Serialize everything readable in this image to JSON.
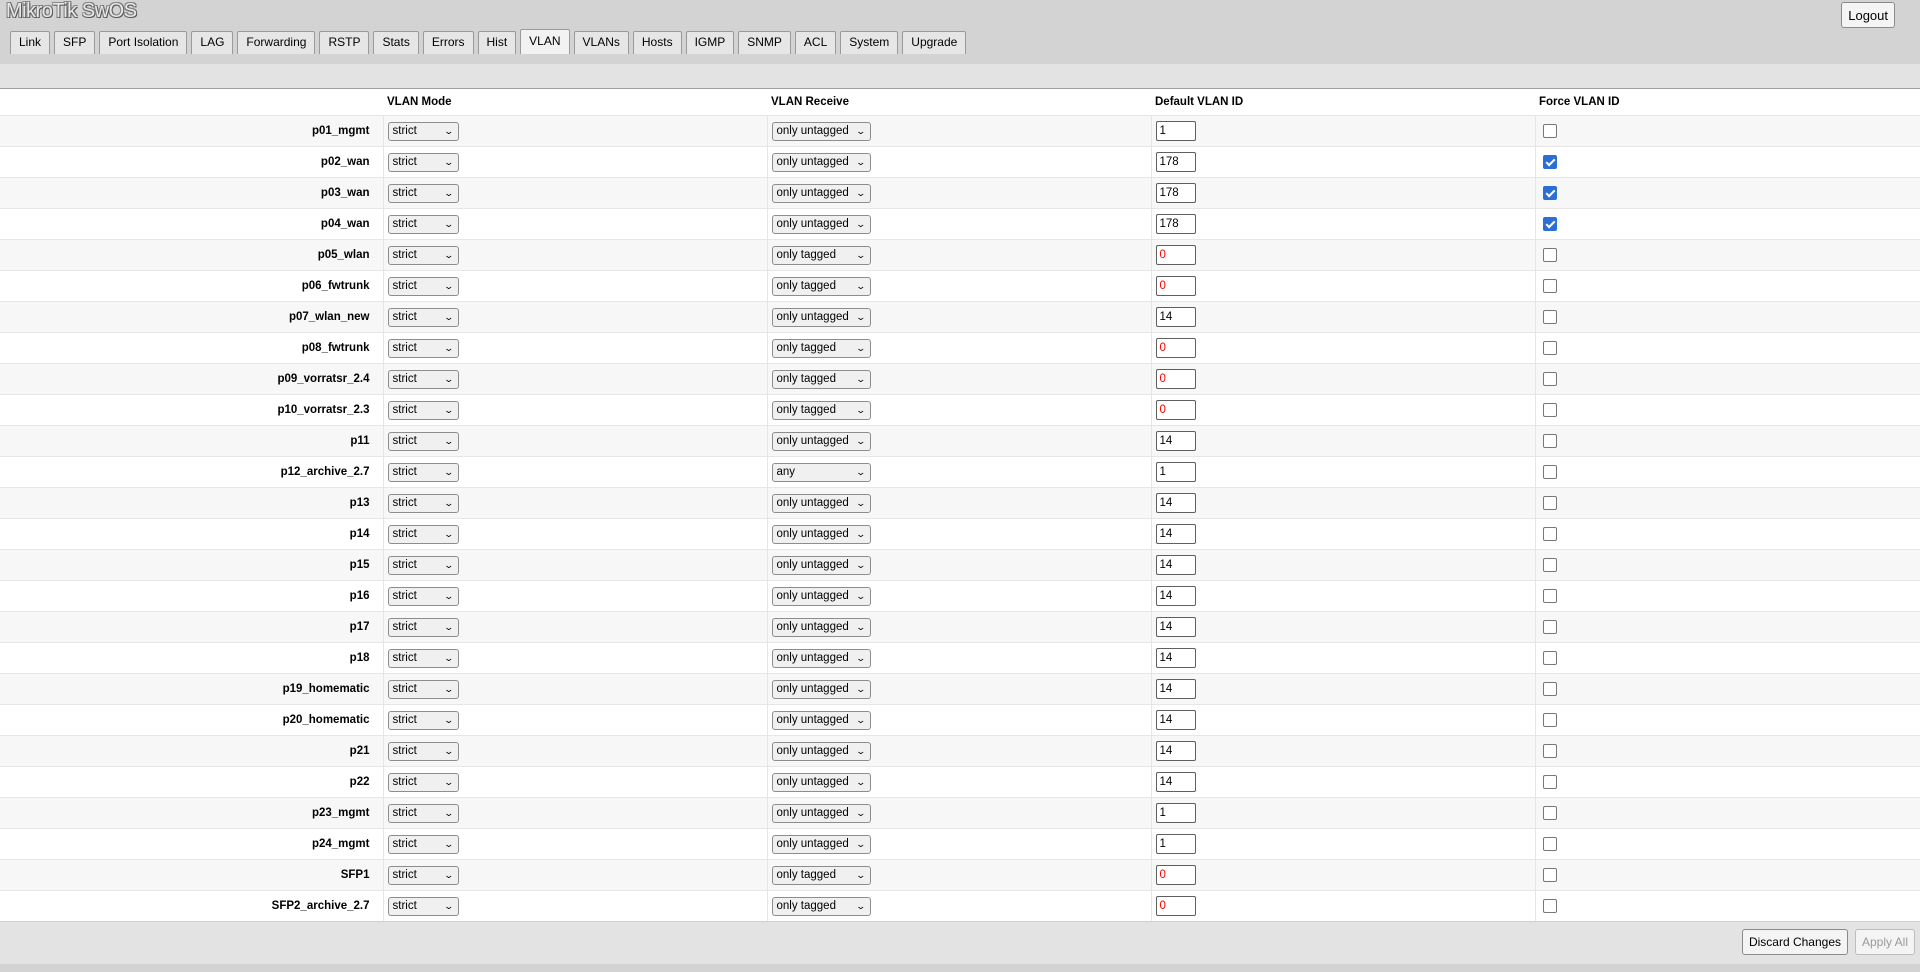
{
  "app": {
    "title": "MikroTik SwOS",
    "logout_label": "Logout"
  },
  "tabs": [
    {
      "label": "Link"
    },
    {
      "label": "SFP"
    },
    {
      "label": "Port Isolation"
    },
    {
      "label": "LAG"
    },
    {
      "label": "Forwarding"
    },
    {
      "label": "RSTP"
    },
    {
      "label": "Stats"
    },
    {
      "label": "Errors"
    },
    {
      "label": "Hist"
    },
    {
      "label": "VLAN",
      "active": true
    },
    {
      "label": "VLANs"
    },
    {
      "label": "Hosts"
    },
    {
      "label": "IGMP"
    },
    {
      "label": "SNMP"
    },
    {
      "label": "ACL"
    },
    {
      "label": "System"
    },
    {
      "label": "Upgrade"
    }
  ],
  "table": {
    "headers": {
      "name": "",
      "mode": "VLAN Mode",
      "receive": "VLAN Receive",
      "default_id": "Default VLAN ID",
      "force": "Force VLAN ID"
    },
    "rows": [
      {
        "name": "p01_mgmt",
        "mode": "strict",
        "receive": "only untagged",
        "vid": "1",
        "force": false
      },
      {
        "name": "p02_wan",
        "mode": "strict",
        "receive": "only untagged",
        "vid": "178",
        "force": true
      },
      {
        "name": "p03_wan",
        "mode": "strict",
        "receive": "only untagged",
        "vid": "178",
        "force": true
      },
      {
        "name": "p04_wan",
        "mode": "strict",
        "receive": "only untagged",
        "vid": "178",
        "force": true
      },
      {
        "name": "p05_wlan",
        "mode": "strict",
        "receive": "only tagged",
        "vid": "0",
        "force": false
      },
      {
        "name": "p06_fwtrunk",
        "mode": "strict",
        "receive": "only tagged",
        "vid": "0",
        "force": false
      },
      {
        "name": "p07_wlan_new",
        "mode": "strict",
        "receive": "only untagged",
        "vid": "14",
        "force": false
      },
      {
        "name": "p08_fwtrunk",
        "mode": "strict",
        "receive": "only tagged",
        "vid": "0",
        "force": false
      },
      {
        "name": "p09_vorratsr_2.4",
        "mode": "strict",
        "receive": "only tagged",
        "vid": "0",
        "force": false
      },
      {
        "name": "p10_vorratsr_2.3",
        "mode": "strict",
        "receive": "only tagged",
        "vid": "0",
        "force": false
      },
      {
        "name": "p11",
        "mode": "strict",
        "receive": "only untagged",
        "vid": "14",
        "force": false
      },
      {
        "name": "p12_archive_2.7",
        "mode": "strict",
        "receive": "any",
        "vid": "1",
        "force": false
      },
      {
        "name": "p13",
        "mode": "strict",
        "receive": "only untagged",
        "vid": "14",
        "force": false
      },
      {
        "name": "p14",
        "mode": "strict",
        "receive": "only untagged",
        "vid": "14",
        "force": false
      },
      {
        "name": "p15",
        "mode": "strict",
        "receive": "only untagged",
        "vid": "14",
        "force": false
      },
      {
        "name": "p16",
        "mode": "strict",
        "receive": "only untagged",
        "vid": "14",
        "force": false
      },
      {
        "name": "p17",
        "mode": "strict",
        "receive": "only untagged",
        "vid": "14",
        "force": false
      },
      {
        "name": "p18",
        "mode": "strict",
        "receive": "only untagged",
        "vid": "14",
        "force": false
      },
      {
        "name": "p19_homematic",
        "mode": "strict",
        "receive": "only untagged",
        "vid": "14",
        "force": false
      },
      {
        "name": "p20_homematic",
        "mode": "strict",
        "receive": "only untagged",
        "vid": "14",
        "force": false
      },
      {
        "name": "p21",
        "mode": "strict",
        "receive": "only untagged",
        "vid": "14",
        "force": false
      },
      {
        "name": "p22",
        "mode": "strict",
        "receive": "only untagged",
        "vid": "14",
        "force": false
      },
      {
        "name": "p23_mgmt",
        "mode": "strict",
        "receive": "only untagged",
        "vid": "1",
        "force": false
      },
      {
        "name": "p24_mgmt",
        "mode": "strict",
        "receive": "only untagged",
        "vid": "1",
        "force": false
      },
      {
        "name": "SFP1",
        "mode": "strict",
        "receive": "only tagged",
        "vid": "0",
        "force": false
      },
      {
        "name": "SFP2_archive_2.7",
        "mode": "strict",
        "receive": "only tagged",
        "vid": "0",
        "force": false
      }
    ]
  },
  "footer": {
    "discard_label": "Discard Changes",
    "apply_label": "Apply All"
  },
  "colors": {
    "zero_vid": "#ff0000",
    "checkbox_on": "#2b6fd6"
  }
}
